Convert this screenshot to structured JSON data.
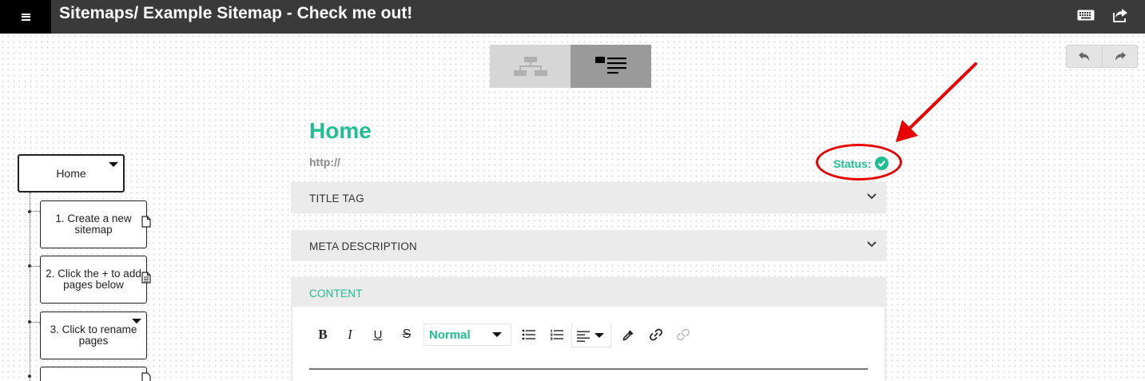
{
  "header": {
    "title": "Sitemaps/ Example Sitemap - Check me out!"
  },
  "icons": {
    "menu": "hamburger-icon",
    "keyboard": "keyboard-icon",
    "share": "share-icon",
    "tree_view": "sitemap-tree-icon",
    "list_view": "list-view-icon",
    "undo": "undo-icon",
    "redo": "redo-icon",
    "status": "check-circle-icon",
    "page": "document-icon"
  },
  "tree": {
    "root": {
      "label": "Home"
    },
    "nodes": [
      {
        "label": "1. Create a new sitemap"
      },
      {
        "label": "2. Click the + to add pages below"
      },
      {
        "label": "3. Click to rename pages"
      }
    ]
  },
  "page": {
    "title": "Home",
    "url": "http://",
    "status_label": "Status:"
  },
  "sections": {
    "title_tag": "TITLE TAG",
    "meta_description": "META DESCRIPTION",
    "content": "CONTENT"
  },
  "editor": {
    "bold": "B",
    "italic": "I",
    "underline": "U",
    "strike": "S",
    "format_value": "Normal"
  },
  "colors": {
    "accent": "#1fbf91",
    "topbar": "#3a3a3a",
    "annotation": "#e80000"
  }
}
